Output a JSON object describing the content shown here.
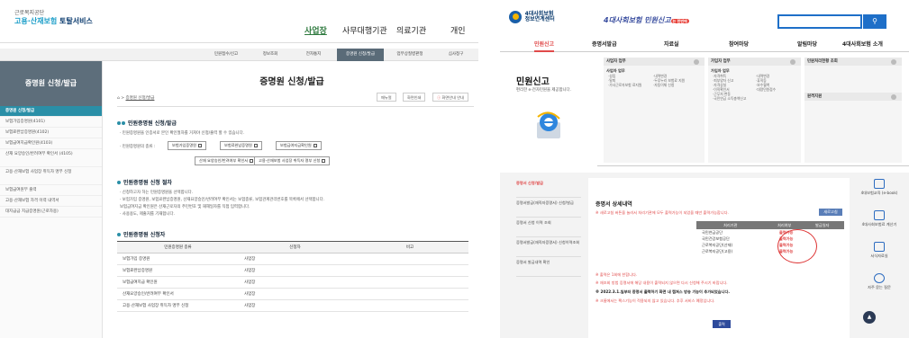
{
  "left": {
    "logo_small": "근로복지공단",
    "logo_main_1": "고용·산재보험",
    "logo_main_2": " 토탈서비스",
    "gnb": [
      "사업장",
      "사무대행기관",
      "의료기관",
      "개인"
    ],
    "subtabs": [
      "민원접수/신고",
      "정보조회",
      "전자통지",
      "증명원 신청/발급",
      "업무상질병판정",
      "심사청구"
    ],
    "lnb_title": "증명원 신청/발급",
    "lnb_items": [
      "증명원 신청/발급",
      "보험가입증명원(4101)",
      "보험료완납증명원(4102)",
      "보험급여지급확인원(4103)",
      "산재 요양승인/반려여부 확인서 (4105)",
      "고용·산재보험 사업장 취득자 명부 신청",
      "보험급여원부 출력",
      "고용·산재보험 자격 이력 내역서",
      "대지급금 지급증명원(근로자용)"
    ],
    "page_title": "증명원 신청/발급",
    "breadcrumb": "증명원 신청/발급",
    "util": [
      "매뉴얼",
      "화면인쇄",
      "화면안내 안내"
    ],
    "sec1_title": "민원증명원 신청/발급",
    "sec1_lines": [
      "· 민원증명원을 인증서로 본인 확인절차를 거쳐야 신청/출력 할 수 있습니다.",
      "· 민원증명원의 종류 :"
    ],
    "sec1_buttons": [
      "보험가입증명원",
      "보험료완납증명원",
      "보험급여지급확인원",
      "산재 요양승인/반려여부 확인서",
      "고용·산재보험 사업장 취득자 명부 신청"
    ],
    "sec2_title": "민원증명원 신청 절차",
    "sec2_lines": [
      "· 신청하고자 하는 민원증명원을 선택합니다.",
      "· 보험가입 증명원, 보험료완납증명원, 산재요양승인/반려여부 확인서는 보험종류, 보험관계관리번호를 목록에서 선택합니다.",
      "  보험급여지급 확인원은 산재근로자의 주민번호 및 재해일자를 직접 입력합니다.",
      "· 사용용도, 제출처를 기재합니다."
    ],
    "sec3_title": "민원증명원 신청자",
    "table_headers": [
      "민원증명원 종류",
      "신청자",
      "비고"
    ],
    "table_rows": [
      [
        "보험가입 증명원",
        "사업장",
        ""
      ],
      [
        "보험료완납증명원",
        "사업장",
        ""
      ],
      [
        "보험급여지급 확인원",
        "사업장",
        ""
      ],
      [
        "산재요양승인/반려여부 확인서",
        "사업장",
        ""
      ],
      [
        "고용·산재보험 사업장 취득자 명부 신청",
        "사업장",
        ""
      ]
    ]
  },
  "right": {
    "logo_line1": "4대사회보험",
    "logo_line2": "정보연계센터",
    "slogan": "4대사회보험 민원신고",
    "slogan_tag": "는 한번에",
    "search_icon": "search-icon",
    "gnb": [
      "민원신고",
      "증명서발급",
      "자료실",
      "참여마당",
      "알림마당",
      "4대사회보험 소개"
    ],
    "side_title": "민원신고",
    "side_desc": "편리한 e-전자민원을 제공합니다.",
    "col1_head": "사업자 업무",
    "col1_sub": "사업자 업무",
    "col1_items_a": [
      "·성립",
      "·탈퇴",
      "·가사근로자보험 료지원"
    ],
    "col1_items_b": [
      "·내역변경",
      "·두루누리 보험료 지원",
      "·자동이체 신청"
    ],
    "col2_head": "가입자 업무",
    "col2_sub": "가입자 업무",
    "col2_items_a": [
      "·자격취득",
      "·피부양자 신고",
      "·자격상실",
      "·이직확인서",
      "·근무처 변동",
      "·국민연금 소득총액신고"
    ],
    "col2_items_b": [
      "·내역변경",
      "·휴직등",
      "·보수월액",
      "·대량민원접수"
    ],
    "col3_head": "민원처리현황 조회",
    "col3_item": "원격지원",
    "lnb": [
      "증명서 신청/발급",
      "증명서발급(재직자증명서) 신청/발급",
      "증명서 신청 이력 조회",
      "증명서발급(재직자증명서) 신청이력조회",
      "증명서 발급내역 확인"
    ],
    "panel_title": "증명서 상세내역",
    "panel_note": "※ 새로고침 버튼을 눌러서 처리기관에 모두 출력가능이 되었을 때만 출력가능합니다.",
    "print_all": "새로고침",
    "ptable_headers": [
      "처리기관",
      "처리여부",
      "발급일자"
    ],
    "ptable_rows": [
      [
        "국민연금공단",
        "출력가능"
      ],
      [
        "국민건강보험공단",
        "출력가능"
      ],
      [
        "근로복지공단(산재)",
        "출력가능"
      ],
      [
        "근로복지공단(고용)",
        "출력가능"
      ]
    ],
    "notes": [
      "※ 출력은 1회에 한합니다.",
      "※ 재조회 방법 증명서에 해당 내용이 출력되지 않으면 다시 신청해 주시기 바랍니다.",
      "※ 2022.3.1.일부터 증명서 출력하기 화면 내 캡쳐스 방송 기능이 추가되었습니다.",
      "※ 크롬에서는 팩스기능이 적용되지 않고 있습니다. 추후 서비스 예정입니다."
    ],
    "ok_button": "출력",
    "quick": [
      "4대보험교육 (e-book)",
      "4대사회보험료 계산기",
      "서식자료실",
      "자주 묻는 질문"
    ],
    "top_button": "▲"
  }
}
